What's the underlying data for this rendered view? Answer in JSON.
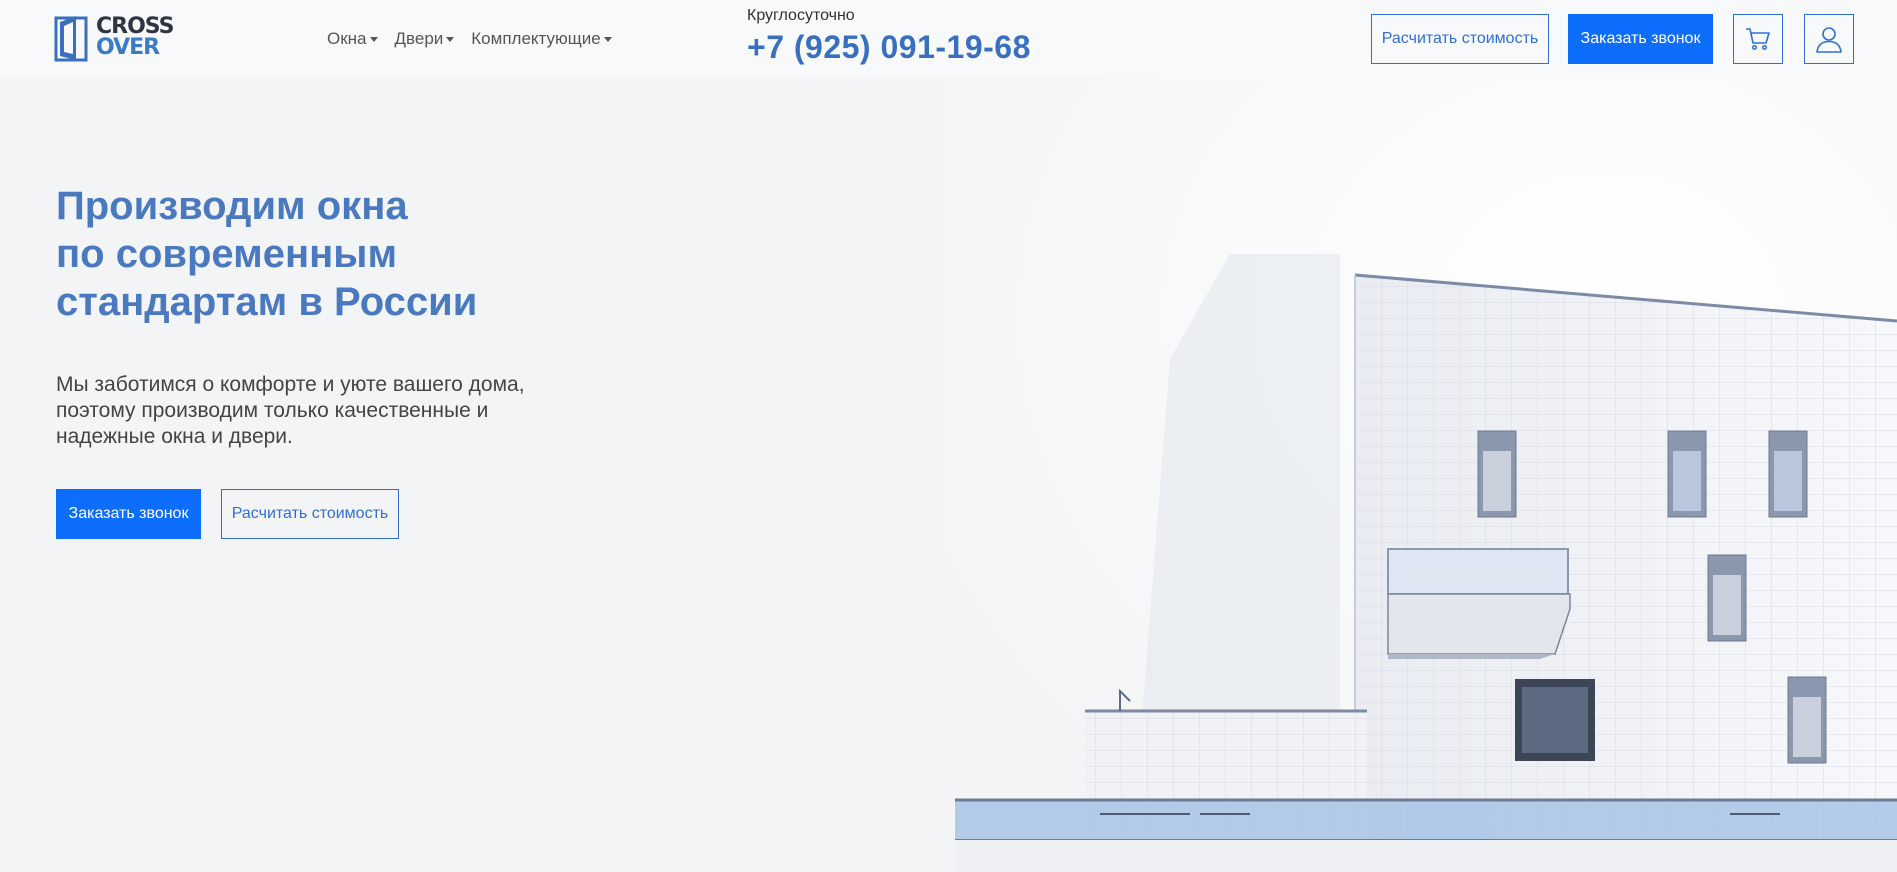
{
  "header": {
    "logo": {
      "line1": "CROSS",
      "line2": "OVER"
    },
    "nav": [
      {
        "label": "Окна"
      },
      {
        "label": "Двери"
      },
      {
        "label": "Комплектующие"
      }
    ],
    "phone": {
      "caption": "Круглосуточно",
      "number": "+7 (925) 091-19-68"
    },
    "calc_button": "Расчитать стоимость",
    "call_button": "Заказать звонок",
    "icons": {
      "cart": "cart-icon",
      "user": "user-icon"
    }
  },
  "hero": {
    "title_lines": [
      "Производим окна",
      "по современным",
      "стандартам в России"
    ],
    "subtitle_lines": [
      "Мы заботимся о комфорте и уюте вашего дома,",
      "поэтому производим только качественные и",
      "надежные окна и двери."
    ],
    "call_button": "Заказать звонок",
    "calc_button": "Расчитать стоимость"
  },
  "colors": {
    "accent": "#0d6efd",
    "title": "#4a79c0",
    "phone": "#3a6fc0",
    "background": "#f3f4f5"
  }
}
